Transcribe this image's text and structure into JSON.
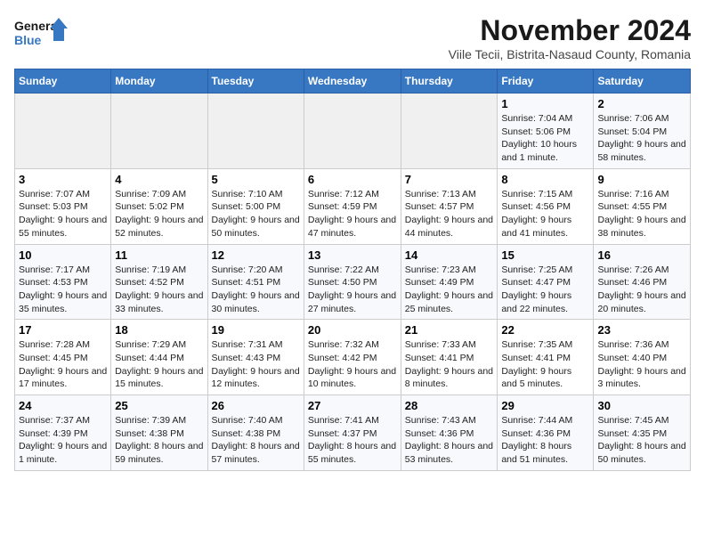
{
  "header": {
    "logo_line1": "General",
    "logo_line2": "Blue",
    "month": "November 2024",
    "location": "Viile Tecii, Bistrita-Nasaud County, Romania"
  },
  "days_of_week": [
    "Sunday",
    "Monday",
    "Tuesday",
    "Wednesday",
    "Thursday",
    "Friday",
    "Saturday"
  ],
  "weeks": [
    [
      {
        "num": "",
        "info": ""
      },
      {
        "num": "",
        "info": ""
      },
      {
        "num": "",
        "info": ""
      },
      {
        "num": "",
        "info": ""
      },
      {
        "num": "",
        "info": ""
      },
      {
        "num": "1",
        "info": "Sunrise: 7:04 AM\nSunset: 5:06 PM\nDaylight: 10 hours and 1 minute."
      },
      {
        "num": "2",
        "info": "Sunrise: 7:06 AM\nSunset: 5:04 PM\nDaylight: 9 hours and 58 minutes."
      }
    ],
    [
      {
        "num": "3",
        "info": "Sunrise: 7:07 AM\nSunset: 5:03 PM\nDaylight: 9 hours and 55 minutes."
      },
      {
        "num": "4",
        "info": "Sunrise: 7:09 AM\nSunset: 5:02 PM\nDaylight: 9 hours and 52 minutes."
      },
      {
        "num": "5",
        "info": "Sunrise: 7:10 AM\nSunset: 5:00 PM\nDaylight: 9 hours and 50 minutes."
      },
      {
        "num": "6",
        "info": "Sunrise: 7:12 AM\nSunset: 4:59 PM\nDaylight: 9 hours and 47 minutes."
      },
      {
        "num": "7",
        "info": "Sunrise: 7:13 AM\nSunset: 4:57 PM\nDaylight: 9 hours and 44 minutes."
      },
      {
        "num": "8",
        "info": "Sunrise: 7:15 AM\nSunset: 4:56 PM\nDaylight: 9 hours and 41 minutes."
      },
      {
        "num": "9",
        "info": "Sunrise: 7:16 AM\nSunset: 4:55 PM\nDaylight: 9 hours and 38 minutes."
      }
    ],
    [
      {
        "num": "10",
        "info": "Sunrise: 7:17 AM\nSunset: 4:53 PM\nDaylight: 9 hours and 35 minutes."
      },
      {
        "num": "11",
        "info": "Sunrise: 7:19 AM\nSunset: 4:52 PM\nDaylight: 9 hours and 33 minutes."
      },
      {
        "num": "12",
        "info": "Sunrise: 7:20 AM\nSunset: 4:51 PM\nDaylight: 9 hours and 30 minutes."
      },
      {
        "num": "13",
        "info": "Sunrise: 7:22 AM\nSunset: 4:50 PM\nDaylight: 9 hours and 27 minutes."
      },
      {
        "num": "14",
        "info": "Sunrise: 7:23 AM\nSunset: 4:49 PM\nDaylight: 9 hours and 25 minutes."
      },
      {
        "num": "15",
        "info": "Sunrise: 7:25 AM\nSunset: 4:47 PM\nDaylight: 9 hours and 22 minutes."
      },
      {
        "num": "16",
        "info": "Sunrise: 7:26 AM\nSunset: 4:46 PM\nDaylight: 9 hours and 20 minutes."
      }
    ],
    [
      {
        "num": "17",
        "info": "Sunrise: 7:28 AM\nSunset: 4:45 PM\nDaylight: 9 hours and 17 minutes."
      },
      {
        "num": "18",
        "info": "Sunrise: 7:29 AM\nSunset: 4:44 PM\nDaylight: 9 hours and 15 minutes."
      },
      {
        "num": "19",
        "info": "Sunrise: 7:31 AM\nSunset: 4:43 PM\nDaylight: 9 hours and 12 minutes."
      },
      {
        "num": "20",
        "info": "Sunrise: 7:32 AM\nSunset: 4:42 PM\nDaylight: 9 hours and 10 minutes."
      },
      {
        "num": "21",
        "info": "Sunrise: 7:33 AM\nSunset: 4:41 PM\nDaylight: 9 hours and 8 minutes."
      },
      {
        "num": "22",
        "info": "Sunrise: 7:35 AM\nSunset: 4:41 PM\nDaylight: 9 hours and 5 minutes."
      },
      {
        "num": "23",
        "info": "Sunrise: 7:36 AM\nSunset: 4:40 PM\nDaylight: 9 hours and 3 minutes."
      }
    ],
    [
      {
        "num": "24",
        "info": "Sunrise: 7:37 AM\nSunset: 4:39 PM\nDaylight: 9 hours and 1 minute."
      },
      {
        "num": "25",
        "info": "Sunrise: 7:39 AM\nSunset: 4:38 PM\nDaylight: 8 hours and 59 minutes."
      },
      {
        "num": "26",
        "info": "Sunrise: 7:40 AM\nSunset: 4:38 PM\nDaylight: 8 hours and 57 minutes."
      },
      {
        "num": "27",
        "info": "Sunrise: 7:41 AM\nSunset: 4:37 PM\nDaylight: 8 hours and 55 minutes."
      },
      {
        "num": "28",
        "info": "Sunrise: 7:43 AM\nSunset: 4:36 PM\nDaylight: 8 hours and 53 minutes."
      },
      {
        "num": "29",
        "info": "Sunrise: 7:44 AM\nSunset: 4:36 PM\nDaylight: 8 hours and 51 minutes."
      },
      {
        "num": "30",
        "info": "Sunrise: 7:45 AM\nSunset: 4:35 PM\nDaylight: 8 hours and 50 minutes."
      }
    ]
  ]
}
